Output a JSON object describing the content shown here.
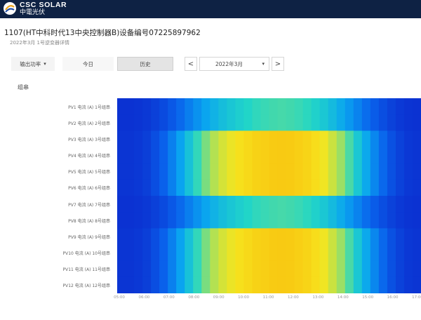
{
  "brand": {
    "name_en": "CSC SOLAR",
    "name_cn": "中電光伏"
  },
  "page": {
    "title": "1107(HT中科时代13中央控制器B)设备编号07225897962",
    "subtitle": "2022年3月 1号逆变器详情"
  },
  "toolbar": {
    "dropdown_label": "输出功率",
    "today_label": "今日",
    "history_label": "历史",
    "prev_symbol": "<",
    "month_label": "2022年3月",
    "next_symbol": ">"
  },
  "section": {
    "label": "组串"
  },
  "chart_data": {
    "type": "heatmap",
    "title": "",
    "rows": [
      "PV1 电流 (A) 1号组串",
      "PV2 电流 (A) 2号组串",
      "PV3 电流 (A) 3号组串",
      "PV4 电流 (A) 4号组串",
      "PV5 电流 (A) 5号组串",
      "PV6 电流 (A) 6号组串",
      "PV7 电流 (A) 7号组串",
      "PV8 电流 (A) 8号组串",
      "PV9 电流 (A) 9号组串",
      "PV10 电流 (A) 10号组串",
      "PV11 电流 (A) 11号组串",
      "PV12 电流 (A) 12号组串"
    ],
    "x_ticks": [
      "05:00",
      "06:00",
      "07:00",
      "08:00",
      "09:00",
      "10:00",
      "11:00",
      "12:00",
      "13:00",
      "14:00",
      "15:00",
      "16:00",
      "17:00"
    ],
    "row_gain": [
      0.55,
      0.55,
      1.0,
      1.0,
      1.0,
      1.0,
      0.55,
      0.55,
      1.0,
      1.0,
      1.0,
      1.0
    ],
    "columns_profile": [
      0.02,
      0.02,
      0.03,
      0.05,
      0.1,
      0.16,
      0.24,
      0.33,
      0.43,
      0.52,
      0.61,
      0.69,
      0.76,
      0.81,
      0.86,
      0.9,
      0.94,
      0.96,
      0.98,
      0.99,
      0.98,
      0.96,
      0.93,
      0.88,
      0.82,
      0.74,
      0.65,
      0.55,
      0.45,
      0.35,
      0.26,
      0.18,
      0.11,
      0.06,
      0.03,
      0.02
    ],
    "colormap": [
      "#0b2fd0",
      "#0a63ec",
      "#0aa4f0",
      "#22d6c7",
      "#a8e05a",
      "#f6e51e",
      "#f8c812"
    ],
    "value_range": [
      0,
      1
    ]
  }
}
